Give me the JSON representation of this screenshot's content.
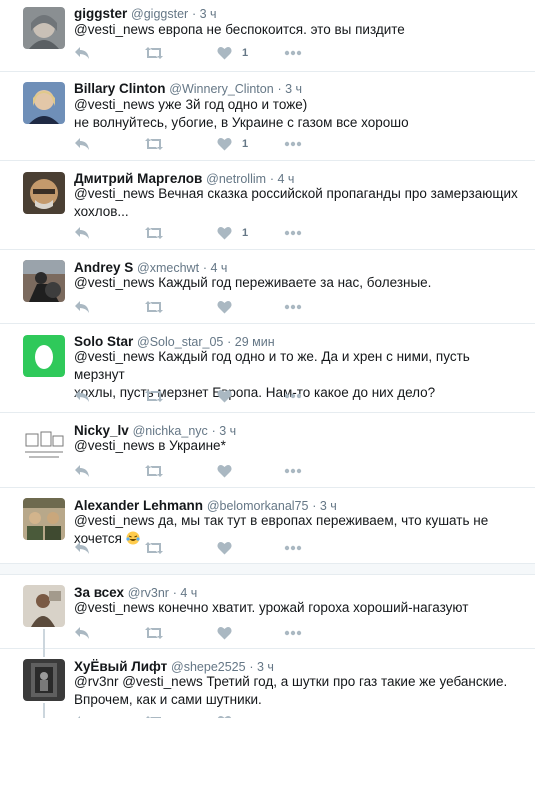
{
  "icons": {
    "reply": "reply-icon",
    "retweet": "retweet-icon",
    "like": "heart-icon",
    "more": "more-dots-icon"
  },
  "colors": {
    "action": "#aab8c2",
    "text": "#14171a",
    "muted": "#657786",
    "egg": "#2fc95a"
  },
  "tweets": [
    {
      "name": "giggster",
      "handle": "@giggster",
      "time": "· 3 ч",
      "mention": "@vesti_news",
      "text": " европа не беспокоится. это вы пиздите",
      "likes": "1"
    },
    {
      "name": "Billary Clinton",
      "handle": "@Winnery_Clinton",
      "time": "· 3 ч",
      "mention": "@vesti_news",
      "text": " уже 3й год одно и тоже)",
      "text2": "не волнуйтесь, убогие, в Украине с газом все хорошо",
      "likes": "1"
    },
    {
      "name": "Дмитрий Маргелов",
      "handle": "@netrollim",
      "time": "· 4 ч",
      "mention": "@vesti_news",
      "text": " Вечная сказка российской пропаганды про замерзающих",
      "text2": "хохлов...",
      "likes": "1"
    },
    {
      "name": "Andrey S",
      "handle": "@xmechwt",
      "time": "· 4 ч",
      "mention": "@vesti_news",
      "text": " Каждый год переживаете за нас, болезные.",
      "likes": ""
    },
    {
      "name": "Solo Star",
      "handle": "@Solo_star_05",
      "time": "· 29 мин",
      "mention": "@vesti_news",
      "text": " Каждый год одно и то же. Да и хрен с ними, пусть мерзнут",
      "text2": "хохлы, пусть мерзнет Европа. Нам-то какое до них дело?",
      "likes": ""
    },
    {
      "name": "Nicky_lv",
      "handle": "@nichka_nyc",
      "time": "· 3 ч",
      "mention": "@vesti_news",
      "text": " в Украине*",
      "likes": ""
    },
    {
      "name": "Alexander Lehmann",
      "handle": "@belomorkanal75",
      "time": "· 3 ч",
      "mention": "@vesti_news",
      "text": " да, мы так тут в европах переживаем, что кушать не хочется",
      "likes": ""
    },
    {
      "name": "За всех",
      "handle": "@rv3nr",
      "time": "· 4 ч",
      "mention": "@vesti_news",
      "text": " конечно хватит. урожай гороха хороший-нагазуют",
      "likes": ""
    },
    {
      "name": "ХуЁвый Лифт",
      "handle": "@shepe2525",
      "time": "· 3 ч",
      "mention": "@rv3nr @vesti_news",
      "text": " Третий год, а шутки про газ такие же уебанские.",
      "text2": "Впрочем, как и сами шутники.",
      "likes": ""
    }
  ]
}
